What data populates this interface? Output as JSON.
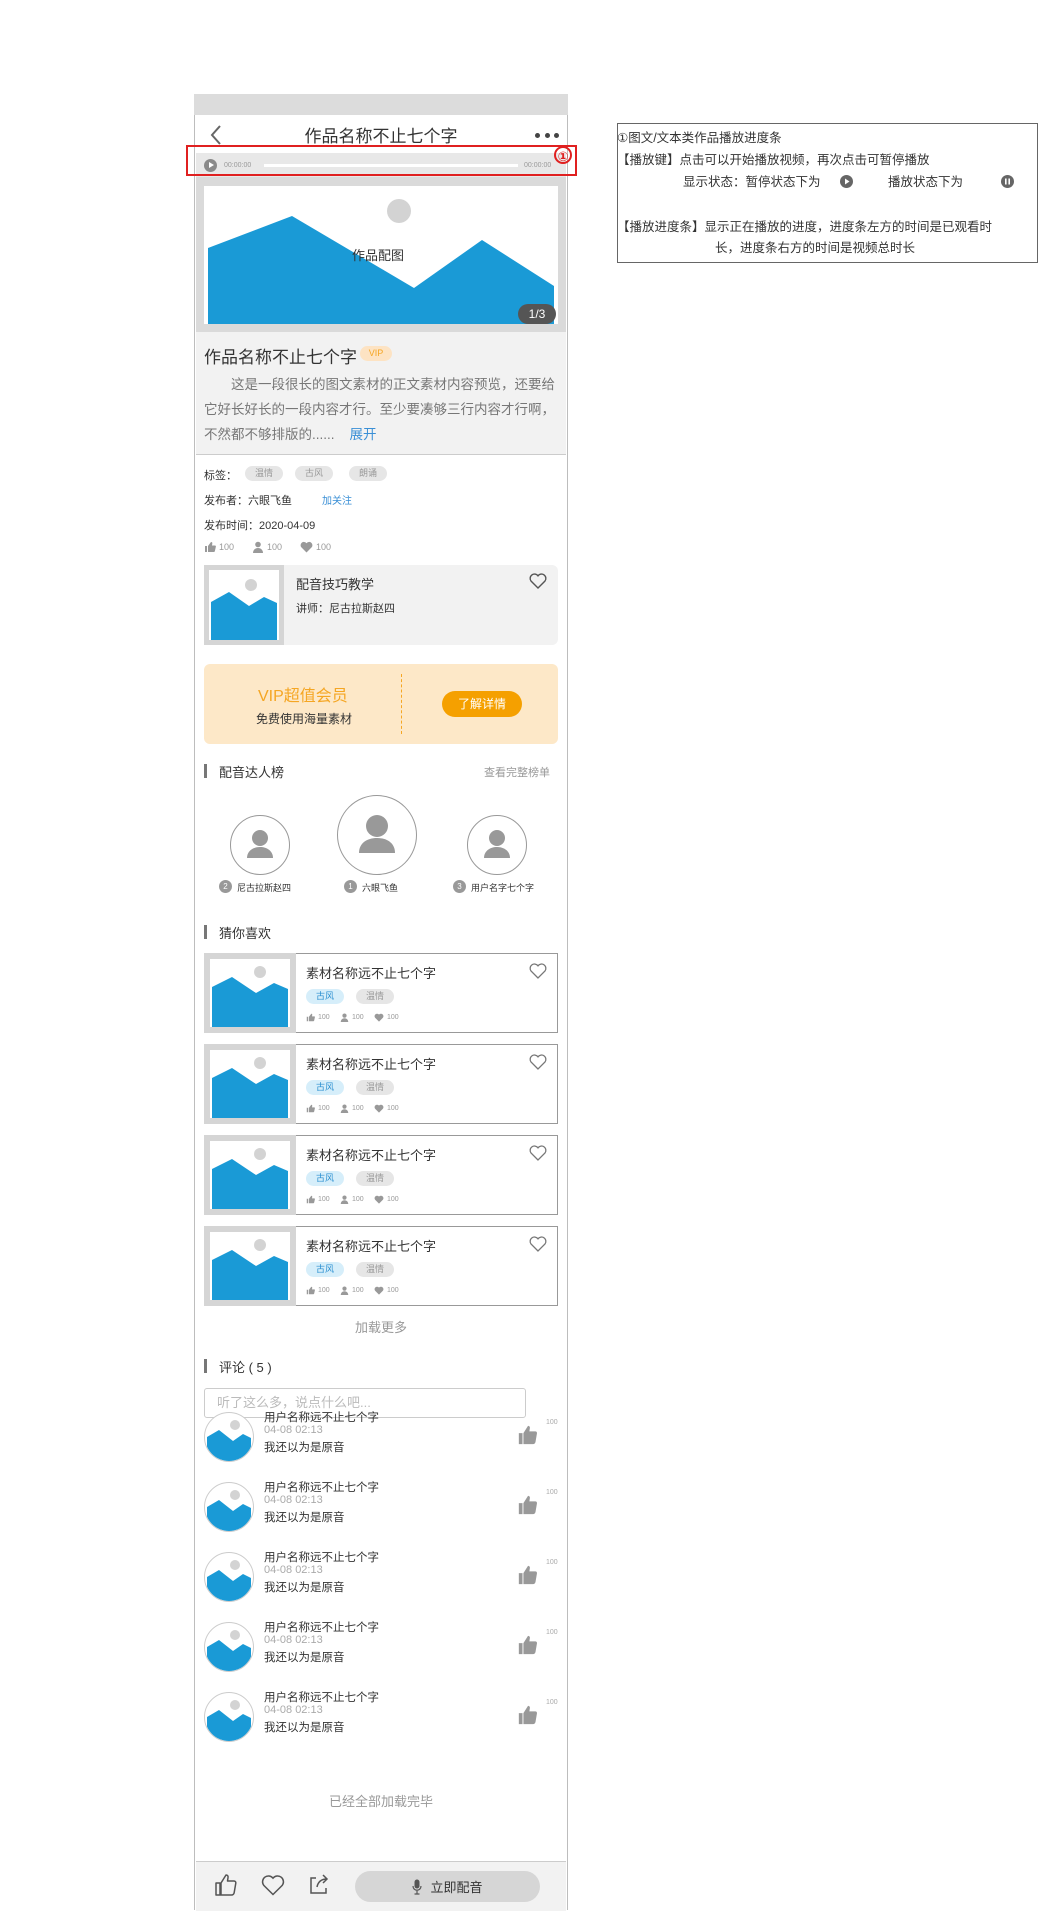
{
  "nav": {
    "title": "作品名称不止七个字"
  },
  "player": {
    "current_time": "00:00:00",
    "total_time": "00:00:00"
  },
  "annotation_number": "①",
  "cover": {
    "label": "作品配图",
    "page_indicator": "1/3"
  },
  "work": {
    "title": "作品名称不止七个字",
    "vip_badge": "VIP",
    "description": "这是一段很长的图文素材的正文素材内容预览，还要给它好长好长的一段内容才行。至少要凑够三行内容才行啊，不然都不够排版的......",
    "expand_label": "展开"
  },
  "meta": {
    "tags_label": "标签：",
    "tags": [
      "温情",
      "古风",
      "朗诵"
    ],
    "publisher_label": "发布者：六眼飞鱼",
    "follow_label": "加关注",
    "time_label": "发布时间：2020-04-09",
    "stats": {
      "likes": "100",
      "users": "100",
      "favorites": "100"
    }
  },
  "course": {
    "title": "配音技巧教学",
    "teacher": "讲师：尼古拉斯赵四"
  },
  "vip_banner": {
    "title": "VIP超值会员",
    "subtitle": "免费使用海量素材",
    "button": "了解详情"
  },
  "ranking": {
    "title": "配音达人榜",
    "link": "查看完整榜单",
    "users": [
      {
        "rank": "2",
        "name": "尼古拉斯赵四"
      },
      {
        "rank": "1",
        "name": "六眼飞鱼"
      },
      {
        "rank": "3",
        "name": "用户名字七个字"
      }
    ]
  },
  "guess": {
    "title": "猜你喜欢",
    "items": [
      {
        "title": "素材名称远不止七个字",
        "tags": [
          "古风",
          "温情"
        ],
        "likes": "100",
        "users": "100",
        "favorites": "100"
      },
      {
        "title": "素材名称远不止七个字",
        "tags": [
          "古风",
          "温情"
        ],
        "likes": "100",
        "users": "100",
        "favorites": "100"
      },
      {
        "title": "素材名称远不止七个字",
        "tags": [
          "古风",
          "温情"
        ],
        "likes": "100",
        "users": "100",
        "favorites": "100"
      },
      {
        "title": "素材名称远不止七个字",
        "tags": [
          "古风",
          "温情"
        ],
        "likes": "100",
        "users": "100",
        "favorites": "100"
      }
    ],
    "load_more": "加载更多"
  },
  "comments": {
    "title": "评论 ( 5 )",
    "input_placeholder": "听了这么多，说点什么吧...",
    "items": [
      {
        "name": "用户名称远不止七个字",
        "time": "04-08 02:13",
        "text": "我还以为是原音",
        "likes": "100"
      },
      {
        "name": "用户名称远不止七个字",
        "time": "04-08 02:13",
        "text": "我还以为是原音",
        "likes": "100"
      },
      {
        "name": "用户名称远不止七个字",
        "time": "04-08 02:13",
        "text": "我还以为是原音",
        "likes": "100"
      },
      {
        "name": "用户名称远不止七个字",
        "time": "04-08 02:13",
        "text": "我还以为是原音",
        "likes": "100"
      },
      {
        "name": "用户名称远不止七个字",
        "time": "04-08 02:13",
        "text": "我还以为是原音",
        "likes": "100"
      }
    ],
    "end_text": "已经全部加载完毕"
  },
  "bottom_bar": {
    "dub_button": "立即配音"
  },
  "note": {
    "line1": "①图文/文本类作品播放进度条",
    "line2": "【播放键】点击可以开始播放视频，再次点击可暂停播放",
    "line3a": "显示状态：暂停状态下为",
    "line3b": "播放状态下为",
    "line4": "【播放进度条】显示正在播放的进度，进度条左方的时间是已观看时",
    "line5": "长，进度条右方的时间是视频总时长"
  },
  "colors": {
    "accent_blue": "#1a9ad6",
    "vip_orange": "#f5a623",
    "highlight_red": "#e02020"
  }
}
